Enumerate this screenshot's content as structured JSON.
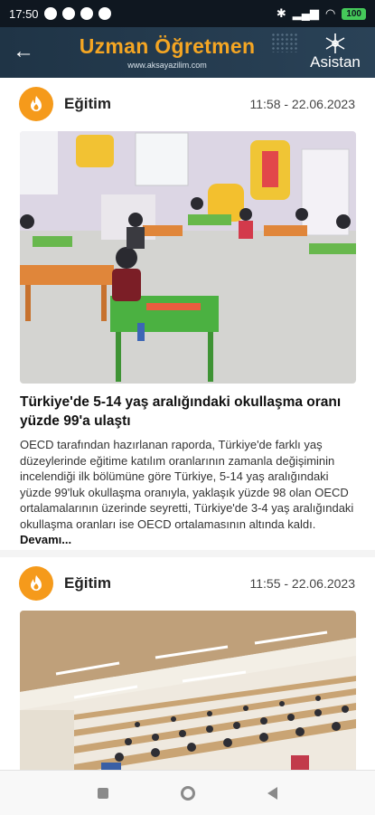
{
  "status_bar": {
    "time": "17:50",
    "battery": "100"
  },
  "app_bar": {
    "title": "Uzman Öğretmen",
    "website": "www.aksayazilim.com",
    "assistant_label": "Asistan"
  },
  "posts": [
    {
      "category": "Eğitim",
      "datetime": "11:58 - 22.06.2023",
      "title": "Türkiye'de 5-14 yaş aralığındaki okullaşma oranı yüzde 99'a ulaştı",
      "excerpt": "OECD tarafından hazırlanan raporda, Türkiye'de farklı yaş düzeylerinde eğitime katılım oranlarının zamanla değişiminin incelendiği ilk bölümüne göre Türkiye, 5-14 yaş aralığındaki yüzde 99'luk okullaşma oranıyla, yaklaşık yüzde 98 olan OECD ortalamalarının üzerinde seyretti, Türkiye'de 3-4 yaş aralığındaki okullaşma oranları ise OECD ortalamasının altında kaldı.",
      "more": "Devamı..."
    },
    {
      "category": "Eğitim",
      "datetime": "11:55 - 22.06.2023"
    }
  ],
  "icons": {
    "category": "flame-icon",
    "back": "arrow-left-icon",
    "assistant": "snowflake-icon"
  },
  "colors": {
    "accent": "#f59a1b",
    "appbar": "#1f3446",
    "statusbar": "#0f1720"
  }
}
